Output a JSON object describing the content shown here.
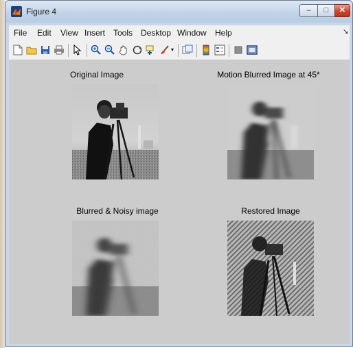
{
  "window": {
    "title": "Figure 4"
  },
  "menu": [
    "File",
    "Edit",
    "View",
    "Insert",
    "Tools",
    "Desktop",
    "Window",
    "Help"
  ],
  "menu_overflow": "↘",
  "toolbar_icons": [
    "new-figure-icon",
    "open-file-icon",
    "save-icon",
    "print-icon",
    "pointer-icon",
    "zoom-in-icon",
    "zoom-out-icon",
    "pan-icon",
    "rotate-3d-icon",
    "data-cursor-icon",
    "brush-icon",
    "brush-dropdown-icon",
    "link-plot-icon",
    "colorbar-icon",
    "legend-icon",
    "hide-plot-tools-icon",
    "show-plot-tools-icon"
  ],
  "plots": [
    {
      "title": "Original Image"
    },
    {
      "title": "Motion Blurred Image at 45*"
    },
    {
      "title": "Blurred & Noisy image"
    },
    {
      "title": "Restored Image"
    }
  ]
}
